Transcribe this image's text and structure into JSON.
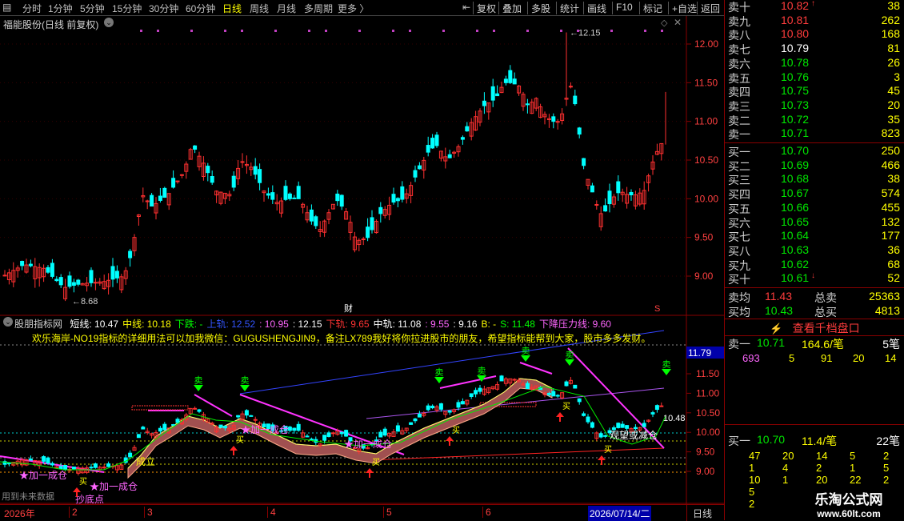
{
  "toolbar": {
    "periods": [
      "分时",
      "1分钟",
      "5分钟",
      "15分钟",
      "30分钟",
      "60分钟",
      "日线",
      "周线",
      "月线",
      "多周期",
      "更多"
    ],
    "active": "日线",
    "right_buttons": [
      "复权",
      "叠加",
      "多股",
      "统计",
      "画线",
      "F10",
      "标记",
      "+自选",
      "返回"
    ]
  },
  "main": {
    "title": "福能股份(日线 前复权)",
    "high_label": "12.15",
    "low_label": "8.68",
    "fin_marker": "财",
    "s_marker": "S",
    "y_ticks": [
      "12.00",
      "11.50",
      "11.00",
      "10.50",
      "10.00",
      "9.50",
      "9.00"
    ]
  },
  "indicator": {
    "name": "股朋指标网",
    "params": [
      {
        "label": "短线: 10.47",
        "color": "#ffffff"
      },
      {
        "label": "中线: 10.18",
        "color": "#ffff00"
      },
      {
        "label": "下跌: -",
        "color": "#00ff00"
      },
      {
        "label": "上轨: 12.52",
        "color": "#3355ff"
      },
      {
        "label": ": 10.95",
        "color": "#ff66ff"
      },
      {
        "label": ": 12.15",
        "color": "#ffffff"
      },
      {
        "label": "下轨: 9.65",
        "color": "#ff3333"
      },
      {
        "label": "中轨: 11.08",
        "color": "#ffffff"
      },
      {
        "label": ": 9.55",
        "color": "#ff66ff"
      },
      {
        "label": ": 9.16",
        "color": "#ffffff"
      },
      {
        "label": "B: -",
        "color": "#ffff00"
      },
      {
        "label": "S: 11.48",
        "color": "#00ff00"
      },
      {
        "label": "下降压力线: 9.60",
        "color": "#ff66ff"
      }
    ],
    "notice": "欢乐海岸-NO19指标的详细用法可以加我微信：GUGUSHENGJIN9，备注LX789我好将你拉进股市的朋友，希望指标能帮到大家，股市多多发财。",
    "price_tag": "11.79",
    "current_label": "10.48",
    "y_ticks": [
      "11.50",
      "11.00",
      "10.50",
      "10.00",
      "9.50",
      "9.00"
    ],
    "texts": {
      "add_cheng": "★加一成仓",
      "add_cheng2": "★加一成仓",
      "add_cheng3": "★加一成仓",
      "add_cheng4": "★加一成仓",
      "chao_di": "抄底点",
      "cheng_li": "成立",
      "guanwang": "观望或减仓",
      "sell": "卖",
      "buy": "买",
      "use_future": "用到未来数据"
    }
  },
  "bottom": {
    "dates": [
      "2026年",
      "2",
      "3",
      "4",
      "5",
      "6"
    ],
    "current_date": "2026/07/14/二",
    "period": "日线"
  },
  "orderbook": {
    "asks": [
      {
        "label": "卖十",
        "price": "10.82",
        "vol": "38",
        "color": "#ff3c3c",
        "up": true
      },
      {
        "label": "卖九",
        "price": "10.81",
        "vol": "262",
        "color": "#ff3c3c"
      },
      {
        "label": "卖八",
        "price": "10.80",
        "vol": "168",
        "color": "#ff3c3c"
      },
      {
        "label": "卖七",
        "price": "10.79",
        "vol": "81",
        "color": "#ffffff"
      },
      {
        "label": "卖六",
        "price": "10.78",
        "vol": "26",
        "color": "#00e600"
      },
      {
        "label": "卖五",
        "price": "10.76",
        "vol": "3",
        "color": "#00e600"
      },
      {
        "label": "卖四",
        "price": "10.75",
        "vol": "45",
        "color": "#00e600"
      },
      {
        "label": "卖三",
        "price": "10.73",
        "vol": "20",
        "color": "#00e600"
      },
      {
        "label": "卖二",
        "price": "10.72",
        "vol": "35",
        "color": "#00e600"
      },
      {
        "label": "卖一",
        "price": "10.71",
        "vol": "823",
        "color": "#00e600"
      }
    ],
    "bids": [
      {
        "label": "买一",
        "price": "10.70",
        "vol": "250",
        "color": "#00e600"
      },
      {
        "label": "买二",
        "price": "10.69",
        "vol": "466",
        "color": "#00e600"
      },
      {
        "label": "买三",
        "price": "10.68",
        "vol": "38",
        "color": "#00e600"
      },
      {
        "label": "买四",
        "price": "10.67",
        "vol": "574",
        "color": "#00e600"
      },
      {
        "label": "买五",
        "price": "10.66",
        "vol": "455",
        "color": "#00e600"
      },
      {
        "label": "买六",
        "price": "10.65",
        "vol": "132",
        "color": "#00e600"
      },
      {
        "label": "买七",
        "price": "10.64",
        "vol": "177",
        "color": "#00e600"
      },
      {
        "label": "买八",
        "price": "10.63",
        "vol": "36",
        "color": "#00e600"
      },
      {
        "label": "买九",
        "price": "10.62",
        "vol": "68",
        "color": "#00e600"
      },
      {
        "label": "买十",
        "price": "10.61",
        "vol": "52",
        "color": "#00e600",
        "down": true
      }
    ],
    "avg_sell": {
      "label": "卖均",
      "price": "11.43",
      "total_label": "总卖",
      "total": "25363"
    },
    "avg_buy": {
      "label": "买均",
      "price": "10.43",
      "total_label": "总买",
      "total": "4813"
    },
    "view_button": "查看千档盘口",
    "sell1": {
      "label": "卖一",
      "price": "10.71",
      "amount": "164.6/笔",
      "count": "5笔"
    },
    "sell1_detail": [
      "693",
      "5",
      "91",
      "20",
      "14"
    ],
    "buy1": {
      "label": "买一",
      "price": "10.70",
      "amount": "11.4/笔",
      "count": "22笔"
    },
    "buy1_detail": [
      [
        "47",
        "20",
        "14",
        "5",
        "2"
      ],
      [
        "1",
        "4",
        "2",
        "1",
        "5"
      ],
      [
        "10",
        "1",
        "20",
        "22",
        "2"
      ],
      [
        "5",
        "",
        "",
        "",
        ""
      ],
      [
        "2",
        "",
        "",
        "",
        ""
      ]
    ],
    "brand": "乐淘公式网",
    "url": "www.60lt.com"
  }
}
